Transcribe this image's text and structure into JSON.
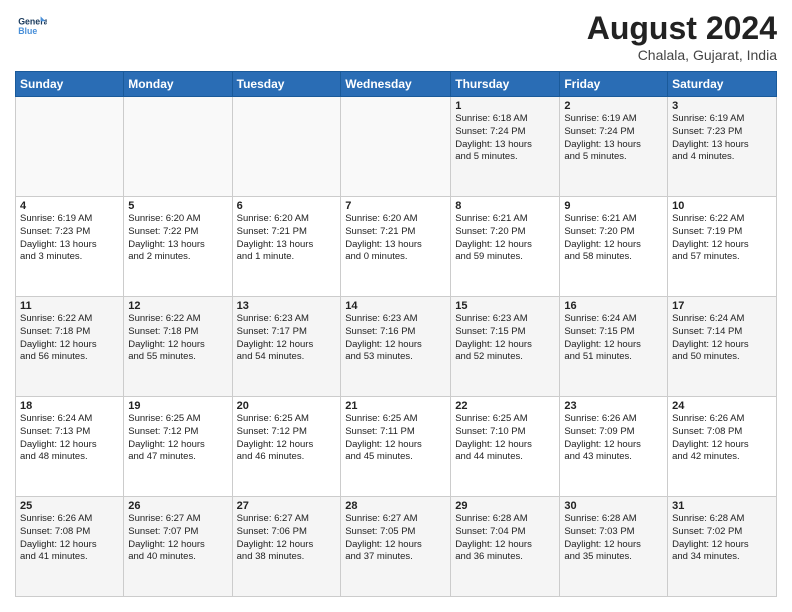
{
  "logo": {
    "line1": "General",
    "line2": "Blue"
  },
  "title": {
    "month_year": "August 2024",
    "location": "Chalala, Gujarat, India"
  },
  "days_of_week": [
    "Sunday",
    "Monday",
    "Tuesday",
    "Wednesday",
    "Thursday",
    "Friday",
    "Saturday"
  ],
  "weeks": [
    [
      {
        "day": "",
        "info": ""
      },
      {
        "day": "",
        "info": ""
      },
      {
        "day": "",
        "info": ""
      },
      {
        "day": "",
        "info": ""
      },
      {
        "day": "1",
        "info": "Sunrise: 6:18 AM\nSunset: 7:24 PM\nDaylight: 13 hours\nand 5 minutes."
      },
      {
        "day": "2",
        "info": "Sunrise: 6:19 AM\nSunset: 7:24 PM\nDaylight: 13 hours\nand 5 minutes."
      },
      {
        "day": "3",
        "info": "Sunrise: 6:19 AM\nSunset: 7:23 PM\nDaylight: 13 hours\nand 4 minutes."
      }
    ],
    [
      {
        "day": "4",
        "info": "Sunrise: 6:19 AM\nSunset: 7:23 PM\nDaylight: 13 hours\nand 3 minutes."
      },
      {
        "day": "5",
        "info": "Sunrise: 6:20 AM\nSunset: 7:22 PM\nDaylight: 13 hours\nand 2 minutes."
      },
      {
        "day": "6",
        "info": "Sunrise: 6:20 AM\nSunset: 7:21 PM\nDaylight: 13 hours\nand 1 minute."
      },
      {
        "day": "7",
        "info": "Sunrise: 6:20 AM\nSunset: 7:21 PM\nDaylight: 13 hours\nand 0 minutes."
      },
      {
        "day": "8",
        "info": "Sunrise: 6:21 AM\nSunset: 7:20 PM\nDaylight: 12 hours\nand 59 minutes."
      },
      {
        "day": "9",
        "info": "Sunrise: 6:21 AM\nSunset: 7:20 PM\nDaylight: 12 hours\nand 58 minutes."
      },
      {
        "day": "10",
        "info": "Sunrise: 6:22 AM\nSunset: 7:19 PM\nDaylight: 12 hours\nand 57 minutes."
      }
    ],
    [
      {
        "day": "11",
        "info": "Sunrise: 6:22 AM\nSunset: 7:18 PM\nDaylight: 12 hours\nand 56 minutes."
      },
      {
        "day": "12",
        "info": "Sunrise: 6:22 AM\nSunset: 7:18 PM\nDaylight: 12 hours\nand 55 minutes."
      },
      {
        "day": "13",
        "info": "Sunrise: 6:23 AM\nSunset: 7:17 PM\nDaylight: 12 hours\nand 54 minutes."
      },
      {
        "day": "14",
        "info": "Sunrise: 6:23 AM\nSunset: 7:16 PM\nDaylight: 12 hours\nand 53 minutes."
      },
      {
        "day": "15",
        "info": "Sunrise: 6:23 AM\nSunset: 7:15 PM\nDaylight: 12 hours\nand 52 minutes."
      },
      {
        "day": "16",
        "info": "Sunrise: 6:24 AM\nSunset: 7:15 PM\nDaylight: 12 hours\nand 51 minutes."
      },
      {
        "day": "17",
        "info": "Sunrise: 6:24 AM\nSunset: 7:14 PM\nDaylight: 12 hours\nand 50 minutes."
      }
    ],
    [
      {
        "day": "18",
        "info": "Sunrise: 6:24 AM\nSunset: 7:13 PM\nDaylight: 12 hours\nand 48 minutes."
      },
      {
        "day": "19",
        "info": "Sunrise: 6:25 AM\nSunset: 7:12 PM\nDaylight: 12 hours\nand 47 minutes."
      },
      {
        "day": "20",
        "info": "Sunrise: 6:25 AM\nSunset: 7:12 PM\nDaylight: 12 hours\nand 46 minutes."
      },
      {
        "day": "21",
        "info": "Sunrise: 6:25 AM\nSunset: 7:11 PM\nDaylight: 12 hours\nand 45 minutes."
      },
      {
        "day": "22",
        "info": "Sunrise: 6:25 AM\nSunset: 7:10 PM\nDaylight: 12 hours\nand 44 minutes."
      },
      {
        "day": "23",
        "info": "Sunrise: 6:26 AM\nSunset: 7:09 PM\nDaylight: 12 hours\nand 43 minutes."
      },
      {
        "day": "24",
        "info": "Sunrise: 6:26 AM\nSunset: 7:08 PM\nDaylight: 12 hours\nand 42 minutes."
      }
    ],
    [
      {
        "day": "25",
        "info": "Sunrise: 6:26 AM\nSunset: 7:08 PM\nDaylight: 12 hours\nand 41 minutes."
      },
      {
        "day": "26",
        "info": "Sunrise: 6:27 AM\nSunset: 7:07 PM\nDaylight: 12 hours\nand 40 minutes."
      },
      {
        "day": "27",
        "info": "Sunrise: 6:27 AM\nSunset: 7:06 PM\nDaylight: 12 hours\nand 38 minutes."
      },
      {
        "day": "28",
        "info": "Sunrise: 6:27 AM\nSunset: 7:05 PM\nDaylight: 12 hours\nand 37 minutes."
      },
      {
        "day": "29",
        "info": "Sunrise: 6:28 AM\nSunset: 7:04 PM\nDaylight: 12 hours\nand 36 minutes."
      },
      {
        "day": "30",
        "info": "Sunrise: 6:28 AM\nSunset: 7:03 PM\nDaylight: 12 hours\nand 35 minutes."
      },
      {
        "day": "31",
        "info": "Sunrise: 6:28 AM\nSunset: 7:02 PM\nDaylight: 12 hours\nand 34 minutes."
      }
    ]
  ]
}
